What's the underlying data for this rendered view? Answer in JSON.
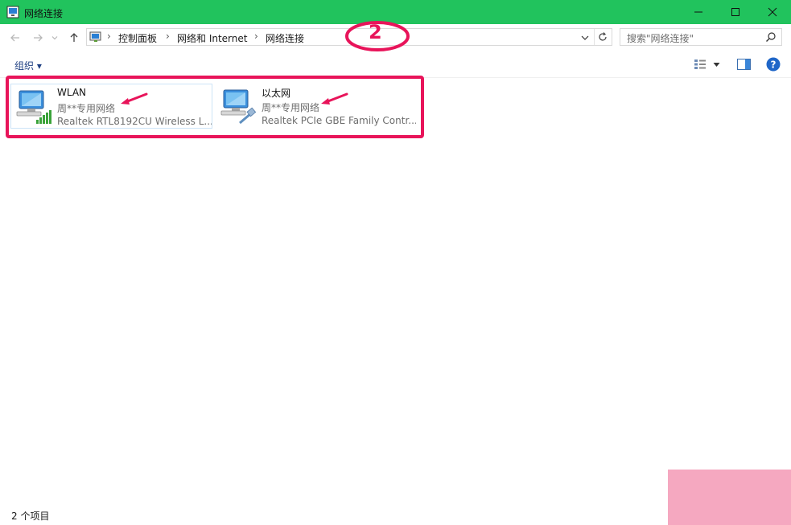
{
  "window": {
    "title": "网络连接",
    "accent": "#21c35d"
  },
  "breadcrumb": {
    "items": [
      "控制面板",
      "网络和 Internet",
      "网络连接"
    ]
  },
  "search": {
    "placeholder": "搜索\"网络连接\""
  },
  "toolbar": {
    "organize_label": "组织 ▾"
  },
  "connections": [
    {
      "name": "WLAN",
      "network": "周**专用网络",
      "adapter": "Realtek RTL8192CU Wireless L...",
      "icon": "wifi-adapter-icon"
    },
    {
      "name": "以太网",
      "network": "周**专用网络",
      "adapter": "Realtek PCIe GBE Family Contr...",
      "icon": "ethernet-adapter-icon"
    }
  ],
  "annotation": {
    "step_label": "2",
    "color": "#e8145a"
  },
  "status": {
    "item_count": "2 个项目"
  }
}
